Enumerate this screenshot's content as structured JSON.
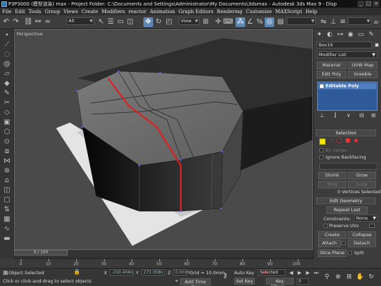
{
  "title": "P3P3000 (模型渲染) max - Project Folder: C:\\Documents and Settings\\Administrator\\My Documents\\3dsmax - Autodesk 3ds Max 9 - Disp",
  "window_buttons": [
    "_",
    "□",
    "×"
  ],
  "menu": [
    "File",
    "Edit",
    "Tools",
    "Group",
    "Views",
    "Create",
    "Modifiers",
    "reactor",
    "Animation",
    "Graph Editors",
    "Rendering",
    "Customize",
    "MAXScript",
    "Help"
  ],
  "toolbar": {
    "filter": "All",
    "refcoord": "View"
  },
  "viewport": {
    "label": "Perspective"
  },
  "cmd": {
    "object_name": "Box19",
    "modifier_list": "Modifier List",
    "buttons_row1": [
      "Material",
      "UVW Map"
    ],
    "buttons_row2": [
      "Edit Poly",
      "Greeble"
    ],
    "stack_item": "Editable Poly",
    "selection": {
      "header": "Selection",
      "by_vertex": "By Vertex",
      "ignore_backfacing": "Ignore Backfacing",
      "shrink": "Shrink",
      "grow": "Grow",
      "ring": "Ring",
      "loop": "Loop",
      "status": "0 Vertices Selected"
    },
    "edit_geometry": {
      "header": "Edit Geometry",
      "repeat_last": "Repeat Last",
      "constraints_label": "Constraints:",
      "constraints_value": "None",
      "preserve_uvs": "Preserve UVs",
      "create": "Create",
      "collapse": "Collapse",
      "attach": "Attach",
      "detach": "Detach",
      "slice_plane": "Slice Plane",
      "split": "Split"
    }
  },
  "timeline": {
    "slider": "0 / 100",
    "ticks": [
      "0",
      "10",
      "20",
      "30",
      "40",
      "50",
      "60",
      "70",
      "80",
      "90",
      "100"
    ]
  },
  "status": {
    "selected": "1 Object Selected",
    "prompt": "Click or click-and-drag to select objects",
    "x": "-150.404n",
    "y": "273.058n",
    "z": "0.0mm",
    "grid": "Grid = 10.0mm",
    "add_time_tag": "Add Time Tag",
    "auto_key": "Auto Key",
    "auto_key_value": "Selected",
    "set_key": "Set Key",
    "key_filters": "Key Filters...",
    "frame": "0",
    "x_label": "X",
    "y_label": "Y",
    "z_label": "Z"
  },
  "colors": {
    "red_edge": "#e02020",
    "accent": "#5e87b5",
    "stack": "#2f5a99",
    "selection_yellow": "#f6e500"
  }
}
